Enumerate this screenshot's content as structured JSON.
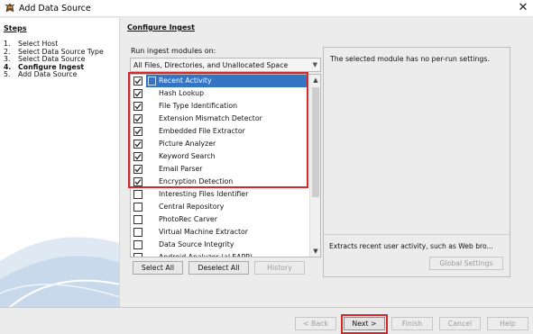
{
  "window": {
    "title": "Add Data Source",
    "close_glyph": "✕"
  },
  "steps": {
    "title": "Steps",
    "items": [
      {
        "num": "1.",
        "label": "Select Host"
      },
      {
        "num": "2.",
        "label": "Select Data Source Type"
      },
      {
        "num": "3.",
        "label": "Select Data Source"
      },
      {
        "num": "4.",
        "label": "Configure Ingest"
      },
      {
        "num": "5.",
        "label": "Add Data Source"
      }
    ]
  },
  "main": {
    "title": "Configure Ingest",
    "run_label": "Run ingest modules on:",
    "dropdown_value": "All Files, Directories, and Unallocated Space",
    "modules": [
      {
        "label": "Recent Activity",
        "checked": true,
        "selected": true
      },
      {
        "label": "Hash Lookup",
        "checked": true
      },
      {
        "label": "File Type Identification",
        "checked": true
      },
      {
        "label": "Extension Mismatch Detector",
        "checked": true
      },
      {
        "label": "Embedded File Extractor",
        "checked": true
      },
      {
        "label": "Picture Analyzer",
        "checked": true
      },
      {
        "label": "Keyword Search",
        "checked": true
      },
      {
        "label": "Email Parser",
        "checked": true
      },
      {
        "label": "Encryption Detection",
        "checked": true
      },
      {
        "label": "Interesting Files Identifier",
        "checked": false
      },
      {
        "label": "Central Repository",
        "checked": false
      },
      {
        "label": "PhotoRec Carver",
        "checked": false
      },
      {
        "label": "Virtual Machine Extractor",
        "checked": false
      },
      {
        "label": "Data Source Integrity",
        "checked": false
      },
      {
        "label": "Android Analyzer (aLEAPP)",
        "checked": false
      }
    ],
    "buttons": {
      "select_all": "Select All",
      "deselect_all": "Deselect All",
      "history": "History"
    }
  },
  "settings": {
    "top_text": "The selected module has no per-run settings.",
    "description": "Extracts recent user activity, such as Web bro...",
    "global_settings": "Global Settings"
  },
  "nav": {
    "back": "< Back",
    "next": "Next >",
    "finish": "Finish",
    "cancel": "Cancel",
    "help": "Help"
  },
  "colors": {
    "selection": "#3474c4",
    "highlight_box": "#d8262d"
  }
}
